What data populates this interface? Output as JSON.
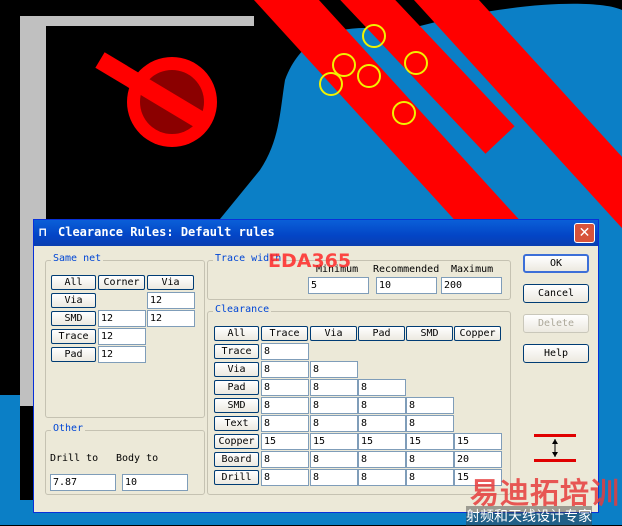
{
  "dialog": {
    "title": "Clearance Rules: Default rules",
    "title_icon": "rule-icon",
    "close_label": "✕"
  },
  "same_net": {
    "label": "Same net",
    "buttons": [
      "All",
      "Corner",
      "Via"
    ],
    "rows": [
      {
        "label": "Via",
        "values": [
          "",
          "12"
        ]
      },
      {
        "label": "SMD",
        "values": [
          "12",
          "12"
        ]
      },
      {
        "label": "Trace",
        "values": [
          "12"
        ]
      },
      {
        "label": "Pad",
        "values": [
          "12"
        ]
      }
    ]
  },
  "trace_width": {
    "label": "Trace width",
    "columns": [
      "Minimum",
      "Recommended",
      "Maximum"
    ],
    "values": [
      "5",
      "10",
      "200"
    ]
  },
  "clearance": {
    "label": "Clearance",
    "all_label": "All",
    "columns": [
      "Trace",
      "Via",
      "Pad",
      "SMD",
      "Copper"
    ],
    "rows": [
      {
        "label": "Trace",
        "values": [
          "8"
        ]
      },
      {
        "label": "Via",
        "values": [
          "8",
          "8"
        ]
      },
      {
        "label": "Pad",
        "values": [
          "8",
          "8",
          "8"
        ]
      },
      {
        "label": "SMD",
        "values": [
          "8",
          "8",
          "8",
          "8"
        ]
      },
      {
        "label": "Text",
        "values": [
          "8",
          "8",
          "8",
          "8"
        ]
      },
      {
        "label": "Copper",
        "values": [
          "15",
          "15",
          "15",
          "15",
          "15"
        ]
      },
      {
        "label": "Board",
        "values": [
          "8",
          "8",
          "8",
          "8",
          "20"
        ]
      },
      {
        "label": "Drill",
        "values": [
          "8",
          "8",
          "8",
          "8",
          "15"
        ]
      }
    ]
  },
  "other": {
    "label": "Other",
    "drill_label": "Drill to",
    "body_label": "Body to",
    "drill_value": "7.87",
    "body_value": "10"
  },
  "actions": {
    "ok": "OK",
    "cancel": "Cancel",
    "delete": "Delete",
    "help": "Help"
  },
  "watermark": {
    "eda": "EDA365",
    "brand": "易迪拓培训",
    "tagline": "射频和天线设计专家"
  },
  "colors": {
    "pcb_red": "#ff0000",
    "copper_blue": "#0b7fc6",
    "via_yellow": "#f2f200",
    "title_blue": "#0a5fd8",
    "dialog_face": "#ece9d8"
  }
}
